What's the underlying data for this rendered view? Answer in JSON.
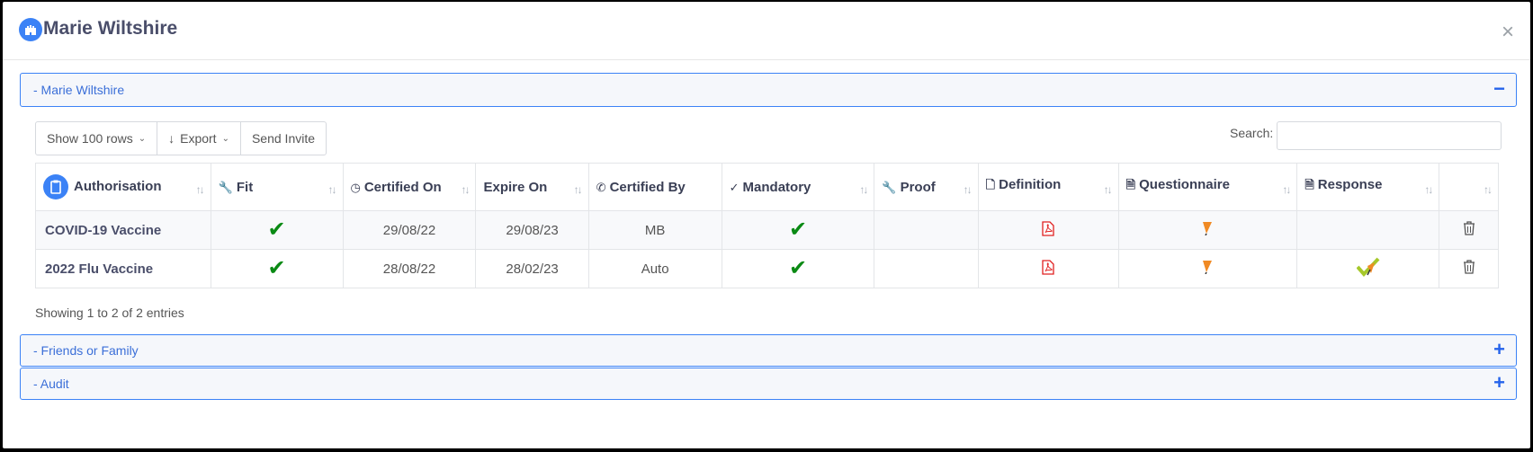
{
  "modal": {
    "title": "Marie Wiltshire",
    "close": "×"
  },
  "panels": [
    {
      "label": "- Marie Wiltshire",
      "toggle": "−"
    },
    {
      "label": "- Friends or Family",
      "toggle": "+"
    },
    {
      "label": "- Audit",
      "toggle": "+"
    }
  ],
  "toolbar": {
    "rows": "Show 100 rows",
    "export": "Export",
    "invite": "Send Invite",
    "search_label": "Search:"
  },
  "table": {
    "headers": [
      "Authorisation",
      "Fit",
      "Certified On",
      "Expire On",
      "Certified By",
      "Mandatory",
      "Proof",
      "Definition",
      "Questionnaire",
      "Response"
    ],
    "rows": [
      {
        "name": "COVID-19 Vaccine",
        "certified_on": "29/08/22",
        "expire_on": "29/08/23",
        "certified_by": "MB"
      },
      {
        "name": "2022 Flu Vaccine",
        "certified_on": "28/08/22",
        "expire_on": "28/02/23",
        "certified_by": "Auto"
      }
    ],
    "check": "✔",
    "sort": "↑↓"
  },
  "info": "Showing 1 to 2 of 2 entries",
  "icons": {
    "pdf": "pdf-icon",
    "questionnaire": "pencil-icon",
    "response": "check-pencil-icon",
    "delete": "trash-icon"
  },
  "colors": {
    "accent": "#3b82f6",
    "check": "#0a8a14",
    "pdf": "#e02020"
  }
}
